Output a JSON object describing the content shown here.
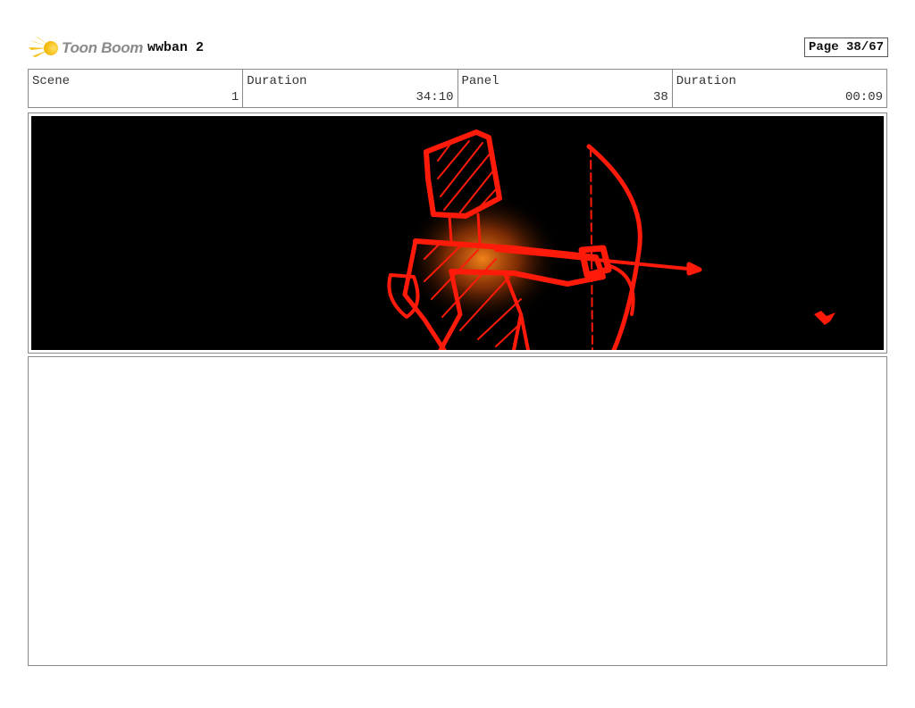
{
  "header": {
    "logo_text": "Toon Boom",
    "project_title": "wwban 2",
    "page_label": "Page 38/67"
  },
  "info": {
    "scene_label": "Scene",
    "scene_value": "1",
    "duration_label": "Duration",
    "duration_value": "34:10",
    "panel_label": "Panel",
    "panel_value": "38",
    "panel_duration_label": "Duration",
    "panel_duration_value": "00:09"
  },
  "colors": {
    "logo_accent": "#f2c21b",
    "sketch_red": "#ff1a0a",
    "glow_orange": "#ff7a1a"
  },
  "panel": {
    "drawing": "red-sketch-archer-drawing-bow"
  },
  "notes": {
    "text": ""
  }
}
